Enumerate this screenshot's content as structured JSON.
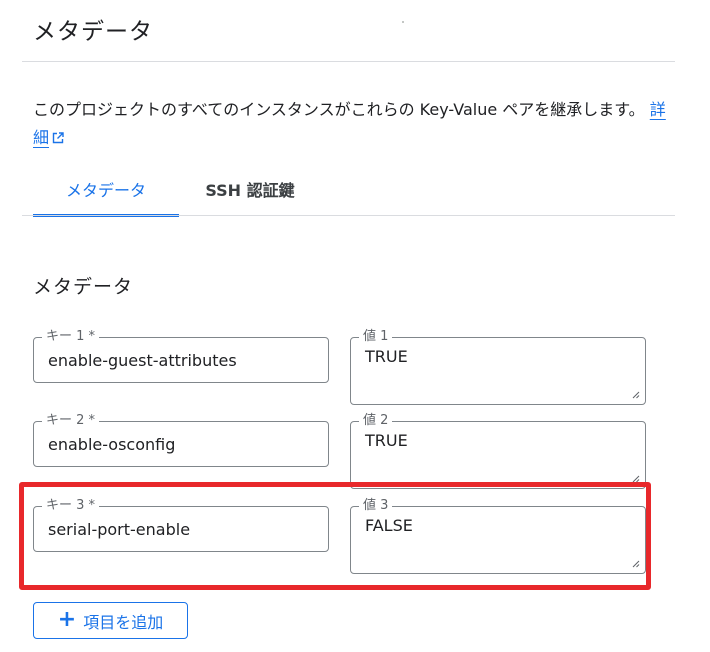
{
  "header": {
    "title": "メタデータ"
  },
  "description": {
    "text": "このプロジェクトのすべてのインスタンスがこれらの Key-Value ペアを継承します。",
    "link_label": "詳細"
  },
  "tabs": [
    {
      "label": "メタデータ",
      "selected": true
    },
    {
      "label": "SSH 認証鍵",
      "selected": false
    }
  ],
  "section": {
    "title": "メタデータ"
  },
  "items": [
    {
      "key_label": "キー 1 *",
      "key_value": "enable-guest-attributes",
      "value_label": "値 1",
      "value_value": "TRUE"
    },
    {
      "key_label": "キー 2 *",
      "key_value": "enable-osconfig",
      "value_label": "値 2",
      "value_value": "TRUE"
    },
    {
      "key_label": "キー 3 *",
      "key_value": "serial-port-enable",
      "value_label": "値 3",
      "value_value": "FALSE"
    }
  ],
  "add_button": {
    "icon": "plus-icon",
    "label": "項目を追加"
  },
  "colors": {
    "accent": "#1a73e8",
    "highlight": "#e8282b",
    "border": "#80868b",
    "divider": "#dadce0"
  }
}
